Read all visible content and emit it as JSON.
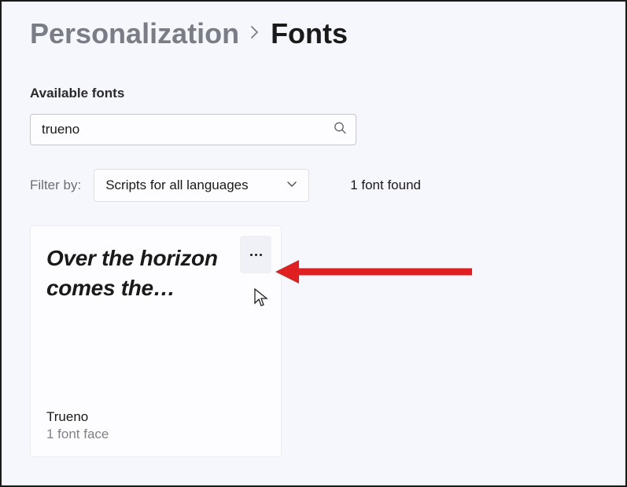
{
  "breadcrumb": {
    "parent": "Personalization",
    "current": "Fonts"
  },
  "section": {
    "available_label": "Available fonts"
  },
  "search": {
    "value": "trueno"
  },
  "filter": {
    "label": "Filter by:",
    "selected": "Scripts for all languages"
  },
  "results": {
    "count_text": "1 font found"
  },
  "fonts": [
    {
      "preview": "Over the horizon comes the…",
      "name": "Trueno",
      "faces": "1 font face"
    }
  ]
}
